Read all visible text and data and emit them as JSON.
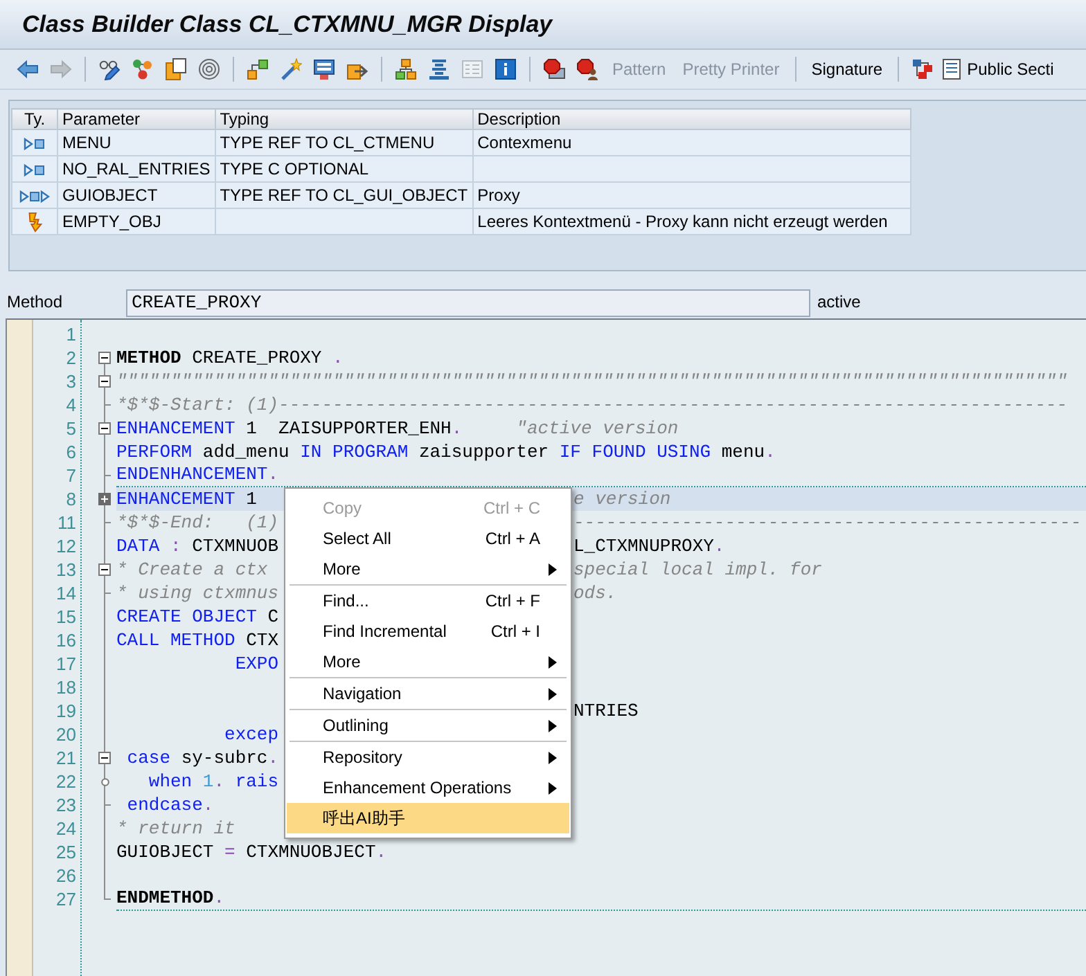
{
  "window": {
    "title": "Class Builder Class CL_CTXMNU_MGR Display"
  },
  "toolbar": [
    [
      {
        "kind": "icon",
        "disabled": false
      },
      {
        "kind": "icon",
        "disabled": true
      }
    ],
    [
      {
        "kind": "icon",
        "disabled": false
      },
      {
        "kind": "icon",
        "disabled": false
      },
      {
        "kind": "icon",
        "disabled": false
      },
      {
        "kind": "icon",
        "disabled": false
      }
    ],
    [
      {
        "kind": "icon",
        "disabled": false
      },
      {
        "kind": "icon",
        "disabled": false
      },
      {
        "kind": "icon",
        "disabled": false
      },
      {
        "kind": "icon",
        "disabled": false
      }
    ],
    [
      {
        "kind": "icon",
        "disabled": false
      },
      {
        "kind": "icon",
        "disabled": false
      },
      {
        "kind": "icon",
        "disabled": true
      },
      {
        "kind": "icon",
        "disabled": false
      }
    ],
    [
      {
        "kind": "icon",
        "disabled": false
      },
      {
        "kind": "icon",
        "disabled": false
      },
      {
        "kind": "text",
        "label": "Pattern",
        "disabled": true
      },
      {
        "kind": "text",
        "label": "Pretty Printer",
        "disabled": true
      }
    ],
    [
      {
        "kind": "text",
        "label": "Signature",
        "disabled": false
      }
    ],
    [
      {
        "kind": "icon",
        "disabled": false
      },
      {
        "kind": "icon_text",
        "label": "Public Secti",
        "disabled": false
      }
    ]
  ],
  "parameters": {
    "columns": [
      "Ty.",
      "Parameter",
      "Typing",
      "Description"
    ],
    "rows": [
      {
        "kind": "importing",
        "parameter": "MENU",
        "typing": "TYPE REF TO CL_CTMENU",
        "description": "Contexmenu"
      },
      {
        "kind": "importing",
        "parameter": "NO_RAL_ENTRIES",
        "typing": "TYPE C OPTIONAL"
      },
      {
        "kind": "returning",
        "parameter": "GUIOBJECT",
        "typing": "TYPE REF TO CL_GUI_OBJECT",
        "description": "Proxy"
      },
      {
        "kind": "exception",
        "parameter": "EMPTY_OBJ",
        "description": "Leeres Kontextmenü - Proxy kann nicht erzeugt werden"
      }
    ]
  },
  "method": {
    "label": "Method",
    "value": "CREATE_PROXY",
    "status": "active"
  },
  "editor": {
    "lines": [
      {
        "number": "1",
        "kind": "plain",
        "selected": false
      },
      {
        "number": "2",
        "kind": "fold",
        "expanded": true,
        "selected": false,
        "tokens": [
          {
            "kind": "bold",
            "text": "METHOD"
          },
          {
            "kind": "name",
            "text": " CREATE_PROXY "
          },
          {
            "kind": "operator",
            "text": "."
          }
        ]
      },
      {
        "number": "3",
        "kind": "fold",
        "expanded": true,
        "selected": false,
        "tokens": [
          {
            "kind": "comment",
            "text": "\"\"\"\"\"\"\"\"\"\"\"\"\"\"\"\"\"\"\"\"\"\"\"\"\"\"\"\"\"\"\"\"\"\"\"\"\"\"\"\"\"\"\"\"\"\"\"\"\"\"\"\"\"\"\"\"\"\"\"\"\"\"\"\"\"\"\"\"\"\"\"\"\"\"\"\"\"\"\"\"\"\"\"\"\"\"\"\""
          }
        ]
      },
      {
        "number": "4",
        "kind": "tick",
        "selected": false,
        "tokens": [
          {
            "kind": "comment",
            "text": "*$*$-Start: (1)-------------------------------------------------------------------------"
          }
        ]
      },
      {
        "number": "5",
        "kind": "fold",
        "expanded": true,
        "selected": false,
        "tokens": [
          {
            "kind": "keyword",
            "text": "ENHANCEMENT"
          },
          {
            "kind": "name",
            "text": " 1  ZAISUPPORTER_ENH"
          },
          {
            "kind": "operator",
            "text": "."
          },
          {
            "kind": "comment",
            "text": "     \"active version"
          }
        ]
      },
      {
        "number": "6",
        "kind": "plain",
        "selected": false,
        "tokens": [
          {
            "kind": "keyword",
            "text": "PERFORM"
          },
          {
            "kind": "name",
            "text": " add_menu "
          },
          {
            "kind": "keyword",
            "text": "IN PROGRAM"
          },
          {
            "kind": "name",
            "text": " zaisupporter "
          },
          {
            "kind": "keyword",
            "text": "IF FOUND USING"
          },
          {
            "kind": "name",
            "text": " menu"
          },
          {
            "kind": "operator",
            "text": "."
          }
        ]
      },
      {
        "number": "7",
        "kind": "tick",
        "selected": false,
        "separator_after": true,
        "tokens": [
          {
            "kind": "keyword",
            "text": "ENDENHANCEMENT"
          },
          {
            "kind": "operator",
            "text": "."
          }
        ]
      },
      {
        "number": "8",
        "kind": "fold",
        "expanded": false,
        "selected": true,
        "tokens": [
          {
            "kind": "keyword",
            "text": "ENHANCEMENT"
          },
          {
            "kind": "name",
            "text": " 1"
          }
        ],
        "tokens_right": [
          {
            "kind": "comment",
            "text": "e version"
          }
        ]
      },
      {
        "number": "11",
        "kind": "tick",
        "selected": false,
        "tokens": [
          {
            "kind": "comment",
            "text": "*$*$-End:   (1)"
          }
        ],
        "tokens_right": [
          {
            "kind": "comment",
            "text": "-----------------------------------------------"
          }
        ]
      },
      {
        "number": "12",
        "kind": "plain",
        "selected": false,
        "tokens": [
          {
            "kind": "keyword",
            "text": "DATA"
          },
          {
            "kind": "operator",
            "text": " :"
          },
          {
            "kind": "name",
            "text": " CTXMNUOB"
          }
        ],
        "tokens_right": [
          {
            "kind": "name",
            "text": "L_CTXMNUPROXY"
          },
          {
            "kind": "operator",
            "text": "."
          }
        ]
      },
      {
        "number": "13",
        "kind": "fold",
        "expanded": true,
        "selected": false,
        "tokens": [
          {
            "kind": "comment",
            "text": "* Create a ctx"
          }
        ],
        "tokens_right": [
          {
            "kind": "comment",
            "text": "special local impl. for"
          }
        ]
      },
      {
        "number": "14",
        "kind": "tick",
        "selected": false,
        "tokens": [
          {
            "kind": "comment",
            "text": "* using ctxmnus"
          }
        ],
        "tokens_right": [
          {
            "kind": "comment",
            "text": "ods."
          }
        ]
      },
      {
        "number": "15",
        "kind": "plain",
        "selected": false,
        "tokens": [
          {
            "kind": "keyword",
            "text": "CREATE OBJECT"
          },
          {
            "kind": "name",
            "text": " C"
          }
        ]
      },
      {
        "number": "16",
        "kind": "plain",
        "selected": false,
        "tokens": [
          {
            "kind": "keyword",
            "text": "CALL METHOD"
          },
          {
            "kind": "name",
            "text": " CTX"
          }
        ]
      },
      {
        "number": "17",
        "kind": "plain",
        "selected": false,
        "tokens": [
          {
            "kind": "keyword",
            "text": "           EXPO"
          }
        ]
      },
      {
        "number": "18",
        "kind": "plain",
        "selected": false
      },
      {
        "number": "19",
        "kind": "plain",
        "selected": false,
        "tokens_right": [
          {
            "kind": "name",
            "text": "NTRIES"
          }
        ]
      },
      {
        "number": "20",
        "kind": "plain",
        "selected": false,
        "tokens": [
          {
            "kind": "keyword",
            "text": "          excep"
          }
        ]
      },
      {
        "number": "21",
        "kind": "fold",
        "expanded": true,
        "selected": false,
        "tokens": [
          {
            "kind": "keyword",
            "text": " case"
          },
          {
            "kind": "name",
            "text": " sy-subrc"
          },
          {
            "kind": "operator",
            "text": "."
          }
        ]
      },
      {
        "number": "22",
        "kind": "node",
        "selected": false,
        "tokens": [
          {
            "kind": "keyword",
            "text": "   when"
          },
          {
            "kind": "number",
            "text": " 1"
          },
          {
            "kind": "operator",
            "text": "."
          },
          {
            "kind": "keyword",
            "text": " rais"
          }
        ]
      },
      {
        "number": "23",
        "kind": "tick",
        "selected": false,
        "tokens": [
          {
            "kind": "keyword",
            "text": " endcase"
          },
          {
            "kind": "operator",
            "text": "."
          }
        ]
      },
      {
        "number": "24",
        "kind": "plain",
        "selected": false,
        "tokens": [
          {
            "kind": "comment",
            "text": "* return it"
          }
        ]
      },
      {
        "number": "25",
        "kind": "plain",
        "selected": false,
        "tokens": [
          {
            "kind": "name",
            "text": "GUIOBJECT "
          },
          {
            "kind": "operator",
            "text": "="
          },
          {
            "kind": "name",
            "text": " CTXMNUOBJECT"
          },
          {
            "kind": "operator",
            "text": "."
          }
        ]
      },
      {
        "number": "26",
        "kind": "plain",
        "selected": false
      },
      {
        "number": "27",
        "kind": "corner",
        "selected": false,
        "separator_after": true,
        "tokens": [
          {
            "kind": "bold",
            "text": "ENDMETHOD"
          },
          {
            "kind": "operator",
            "text": "."
          }
        ]
      }
    ]
  },
  "context_menu": {
    "groups": [
      [
        {
          "label": "Copy",
          "shortcut": "Ctrl + C",
          "disabled": true,
          "submenu": false,
          "selected": false
        },
        {
          "label": "Select All",
          "shortcut": "Ctrl + A",
          "disabled": false,
          "submenu": false,
          "selected": false
        },
        {
          "label": "More",
          "disabled": false,
          "submenu": true,
          "selected": false
        }
      ],
      [
        {
          "label": "Find...",
          "shortcut": "Ctrl + F",
          "disabled": false,
          "submenu": false,
          "selected": false
        },
        {
          "label": "Find Incremental",
          "shortcut": "Ctrl + I",
          "disabled": false,
          "submenu": false,
          "selected": false
        },
        {
          "label": "More",
          "disabled": false,
          "submenu": true,
          "selected": false
        }
      ],
      [
        {
          "label": "Navigation",
          "disabled": false,
          "submenu": true,
          "selected": false
        }
      ],
      [
        {
          "label": "Outlining",
          "disabled": false,
          "submenu": true,
          "selected": false
        }
      ],
      [
        {
          "label": "Repository",
          "disabled": false,
          "submenu": true,
          "selected": false
        },
        {
          "label": "Enhancement Operations",
          "disabled": false,
          "submenu": true,
          "selected": false
        },
        {
          "label": "呼出AI助手",
          "disabled": false,
          "submenu": false,
          "selected": true
        }
      ]
    ]
  }
}
